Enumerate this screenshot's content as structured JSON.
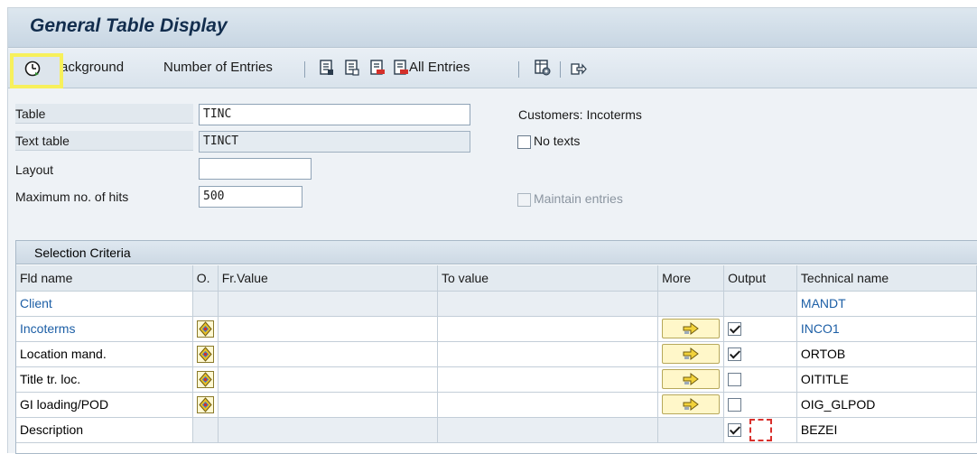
{
  "window": {
    "title": "General Table Display"
  },
  "toolbar": {
    "background_label": "Background",
    "entries_label": "Number of Entries",
    "all_entries_label": "All Entries",
    "icons": [
      "clock-icon",
      "select-all-icon",
      "deselect-icon",
      "delete-icon",
      "all-entries-icon",
      "table-settings-icon",
      "export-icon"
    ]
  },
  "form": {
    "table_label": "Table",
    "table_value": "TINC",
    "table_desc": "Customers: Incoterms",
    "text_table_label": "Text table",
    "text_table_value": "TINCT",
    "no_texts_label": "No texts",
    "layout_label": "Layout",
    "layout_value": "",
    "max_hits_label": "Maximum no. of hits",
    "max_hits_value": "500",
    "maintain_label": "Maintain entries"
  },
  "selection": {
    "title": "Selection Criteria",
    "columns": {
      "fld_name": "Fld name",
      "option": "O.",
      "from": "Fr.Value",
      "to": "To value",
      "more": "More",
      "output": "Output",
      "tech": "Technical name"
    },
    "rows": [
      {
        "name": "Client",
        "tech": "MANDT",
        "key": true,
        "editable": false,
        "output": null
      },
      {
        "name": "Incoterms",
        "tech": "INCO1",
        "key": true,
        "editable": true,
        "output": true
      },
      {
        "name": "Location mand.",
        "tech": "ORTOB",
        "key": false,
        "editable": true,
        "output": true
      },
      {
        "name": "Title tr. loc.",
        "tech": "OITITLE",
        "key": false,
        "editable": true,
        "output": false
      },
      {
        "name": "GI loading/POD",
        "tech": "OIG_GLPOD",
        "key": false,
        "editable": true,
        "output": false
      },
      {
        "name": "Description",
        "tech": "BEZEI",
        "key": false,
        "editable": false,
        "output": true
      }
    ]
  },
  "colors": {
    "key_blue": "#1d5fa6",
    "highlight_yellow": "#f7f05b",
    "more_yellow": "#fff7c9"
  }
}
